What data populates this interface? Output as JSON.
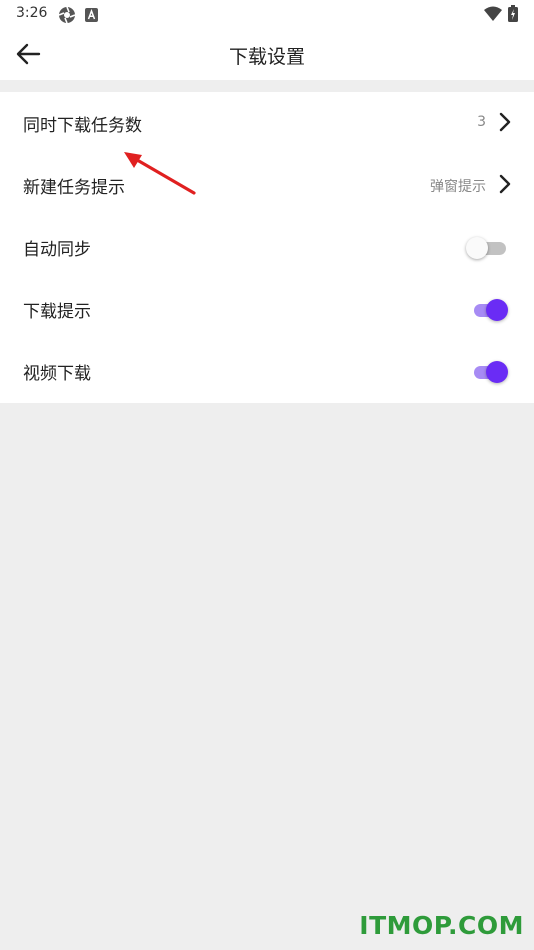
{
  "status_bar": {
    "time": "3:26",
    "icons": [
      "aperture-icon",
      "a-badge-icon",
      "wifi-icon",
      "battery-charging-icon"
    ]
  },
  "header": {
    "title": "下载设置",
    "back_icon": "arrow-left-icon"
  },
  "settings": {
    "concurrent_downloads": {
      "label": "同时下载任务数",
      "value": "3"
    },
    "new_task_prompt": {
      "label": "新建任务提示",
      "value": "弹窗提示"
    },
    "auto_sync": {
      "label": "自动同步",
      "enabled": false
    },
    "download_prompt": {
      "label": "下载提示",
      "enabled": true
    },
    "video_download": {
      "label": "视频下载",
      "enabled": true
    }
  },
  "colors": {
    "accent": "#6a2cf5",
    "accent_track": "#a78bf4",
    "annotation_red": "#e02020",
    "watermark_green": "#2e9b3a"
  },
  "watermark": "ITMOP.COM"
}
